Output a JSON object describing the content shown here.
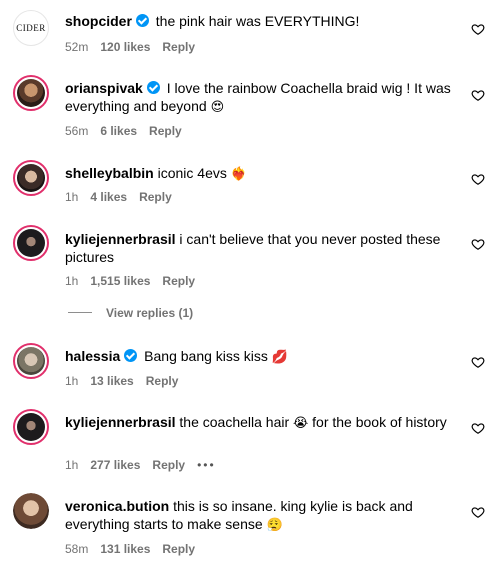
{
  "comments": [
    {
      "user": "shopcider",
      "verified": true,
      "text": "the pink hair was EVERYTHING!",
      "time": "52m",
      "likes": "120 likes",
      "reply": "Reply",
      "avatar_label": "CIDER"
    },
    {
      "user": "orianspivak",
      "verified": true,
      "text": "I love the rainbow Coachella braid wig ! It was everything and beyond",
      "emoji": "😍",
      "time": "56m",
      "likes": "6 likes",
      "reply": "Reply"
    },
    {
      "user": "shelleybalbin",
      "verified": false,
      "text": "iconic 4evs",
      "emoji": "❤️‍🔥",
      "time": "1h",
      "likes": "4 likes",
      "reply": "Reply"
    },
    {
      "user": "kyliejennerbrasil",
      "verified": false,
      "text": "i can't believe that you never posted these pictures",
      "time": "1h",
      "likes": "1,515 likes",
      "reply": "Reply"
    },
    {
      "user": "halessia",
      "verified": true,
      "text": "Bang bang kiss kiss",
      "emoji": "💋",
      "time": "1h",
      "likes": "13 likes",
      "reply": "Reply"
    },
    {
      "user": "kyliejennerbrasil",
      "verified": false,
      "text": "the coachella hair",
      "emoji": "😭",
      "text2": "for the book of history",
      "time": "1h",
      "likes": "277 likes",
      "reply": "Reply",
      "more": "•••"
    },
    {
      "user": "veronica.bution",
      "verified": false,
      "text": "this is so insane. king kylie is back and everything starts to make sense",
      "emoji": "😮‍💨",
      "time": "58m",
      "likes": "131 likes",
      "reply": "Reply"
    }
  ],
  "view_replies": "View replies (1)",
  "colors": {
    "verified": "#0095f6",
    "muted": "#737373",
    "ring": "#e1306c"
  },
  "icons": {
    "like": "heart-outline-icon"
  }
}
